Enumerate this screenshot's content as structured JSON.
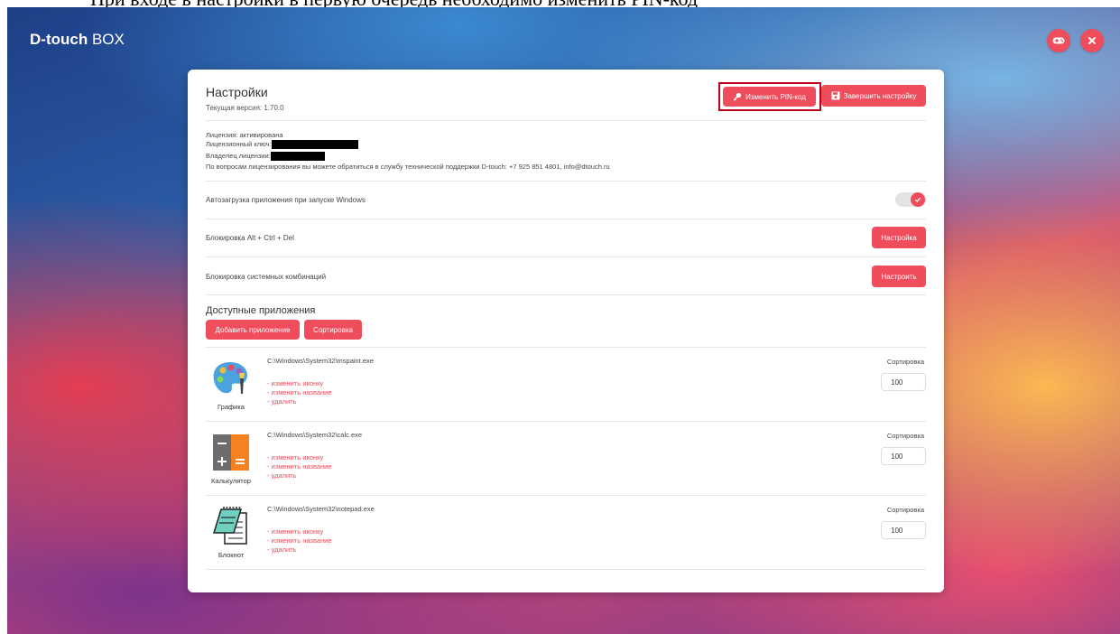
{
  "caption": "При входе в настройки в первую очередь необходимо изменить PIN-код",
  "app": {
    "brand_bold": "D-touch",
    "brand_rest": " BOX"
  },
  "top_buttons": {
    "gamepad_icon": "gamepad-icon",
    "close_icon": "close-icon"
  },
  "colors": {
    "accent": "#ef4c5c",
    "highlight_border": "#c0001a"
  },
  "settings": {
    "title": "Настройки",
    "version": "Текущая версия: 1.70.0",
    "change_pin_label": "Изменить PIN-код",
    "finish_label": "Завершить настройку"
  },
  "license": {
    "status": "Лицензия: активирована",
    "key_label": "Лицензионный ключ:",
    "owner_label": "Владелец лицензии:",
    "support": "По вопросам лицензирования вы можете обратиться в службу технической поддержки D-touch: +7 925 851 4801, info@dtouch.ru"
  },
  "options": {
    "autostart": {
      "label": "Автозагрузка приложения при запуске Windows",
      "enabled": true
    },
    "altctrldel": {
      "label": "Блокировка Alt + Ctrl + Del",
      "button": "Настройка"
    },
    "syscombo": {
      "label": "Блокировка системных комбинаций",
      "button": "Настроить"
    }
  },
  "apps_section": {
    "title": "Доступные приложения",
    "add_label": "Добавить приложение",
    "sort_label": "Сортировка"
  },
  "apps": [
    {
      "name": "Графика",
      "path": "C:\\Windows\\System32\\mspaint.exe",
      "icon": "paint-palette-icon",
      "change_icon": "- изменить иконку",
      "rename": "- изменить название",
      "delete": "- удалить",
      "sort_label": "Сортировка",
      "sort_value": "100"
    },
    {
      "name": "Калькулятор",
      "path": "C:\\Windows\\System32\\calc.exe",
      "icon": "calculator-icon",
      "change_icon": "- изменить иконку",
      "rename": "- изменить название",
      "delete": "- удалить",
      "sort_label": "Сортировка",
      "sort_value": "100"
    },
    {
      "name": "Блокнот",
      "path": "C:\\Windows\\System32\\notepad.exe",
      "icon": "notepad-icon",
      "change_icon": "- изменить иконку",
      "rename": "- изменить название",
      "delete": "- удалить",
      "sort_label": "Сортировка",
      "sort_value": "100"
    }
  ]
}
